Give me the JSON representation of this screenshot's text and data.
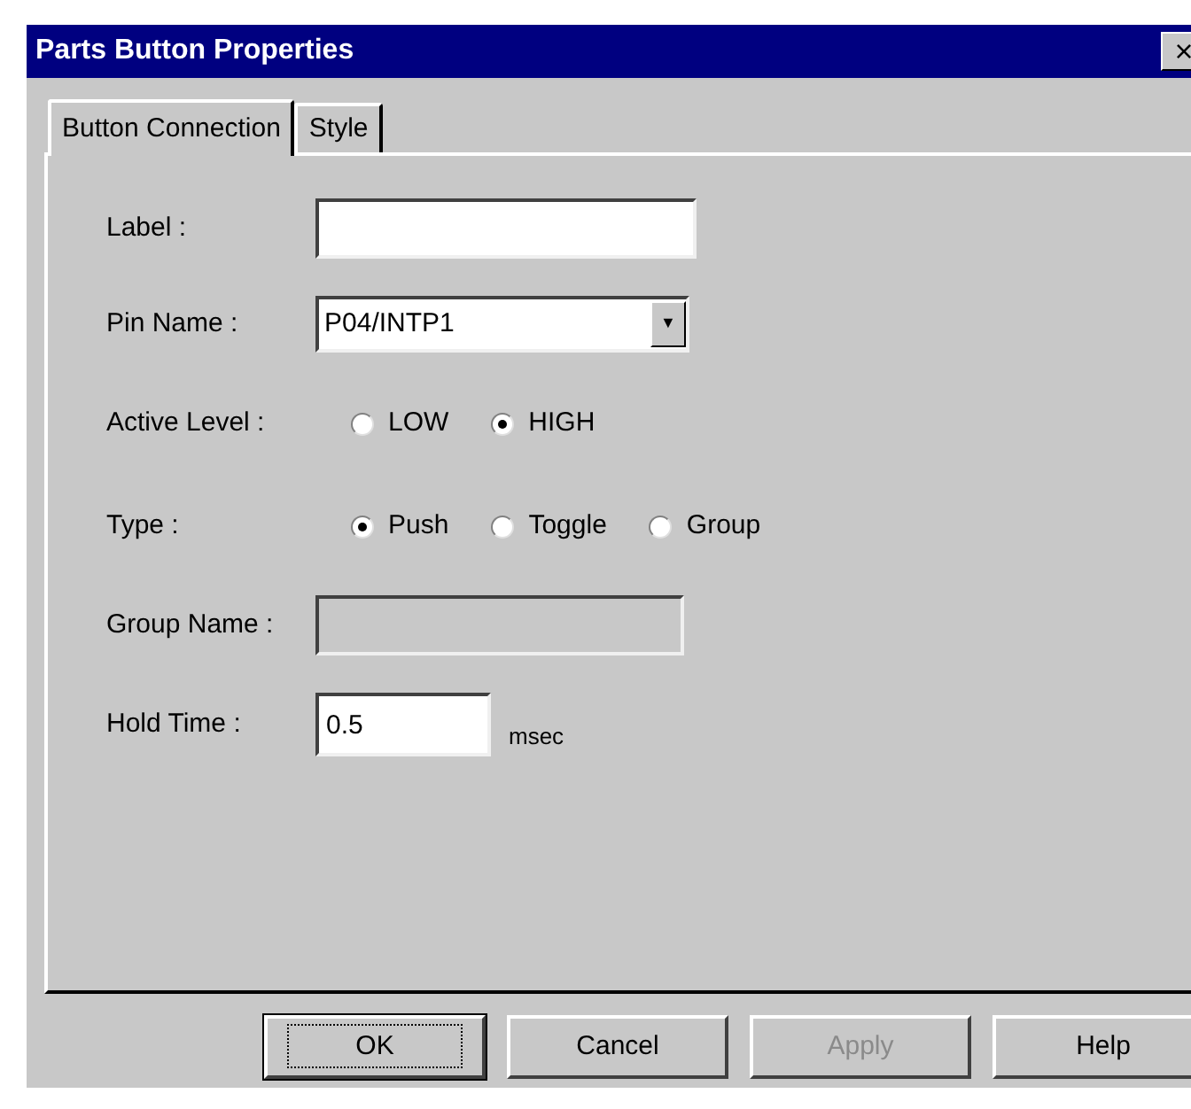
{
  "window": {
    "title": "Parts Button Properties",
    "close": "×"
  },
  "tabs": [
    {
      "label": "Button Connection",
      "selected": true
    },
    {
      "label": "Style",
      "selected": false
    }
  ],
  "form": {
    "label": {
      "label": "Label :"
    },
    "pin_name": {
      "label": "Pin Name :",
      "value": "P04/INTP1",
      "arrow": "▼"
    },
    "active_level": {
      "label": "Active Level :",
      "options": [
        {
          "label": "LOW",
          "selected": false
        },
        {
          "label": "HIGH",
          "selected": true
        }
      ]
    },
    "type": {
      "label": "Type :",
      "options": [
        {
          "label": "Push",
          "selected": true
        },
        {
          "label": "Toggle",
          "selected": false
        },
        {
          "label": "Group",
          "selected": false
        }
      ]
    },
    "group_name": {
      "label": "Group Name :",
      "disabled": true
    },
    "hold_time": {
      "label": "Hold Time :",
      "value": "0.5",
      "unit": "msec"
    }
  },
  "buttons": [
    {
      "label": "OK",
      "default": true,
      "disabled": false
    },
    {
      "label": "Cancel",
      "default": false,
      "disabled": false
    },
    {
      "label": "Apply",
      "default": false,
      "disabled": true
    },
    {
      "label": "Help",
      "default": false,
      "disabled": false
    }
  ]
}
